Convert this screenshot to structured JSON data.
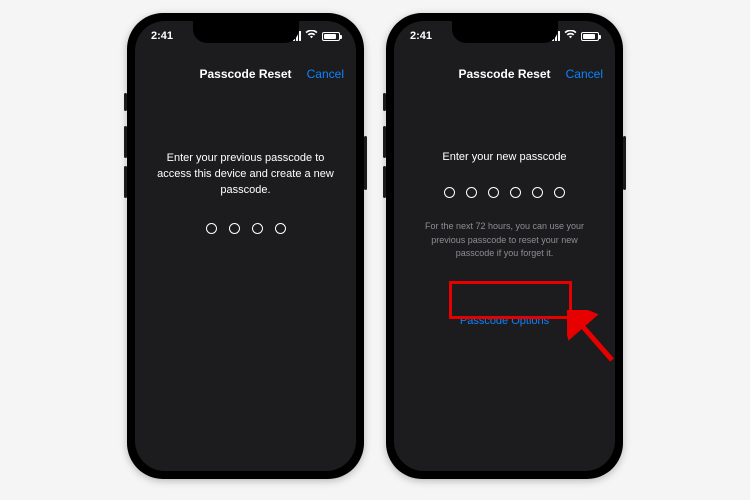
{
  "status": {
    "time": "2:41"
  },
  "nav": {
    "title": "Passcode Reset",
    "cancel": "Cancel"
  },
  "screenA": {
    "prompt": "Enter your previous passcode to access this device and create a new passcode.",
    "dot_count": 4
  },
  "screenB": {
    "prompt": "Enter your new passcode",
    "hint": "For the next 72 hours, you can use your previous passcode to reset your new passcode if you forget it.",
    "options_label": "Passcode Options",
    "dot_count": 6
  },
  "annotation": {
    "highlight_target": "passcode-options-button",
    "arrow_color": "#e60000"
  }
}
